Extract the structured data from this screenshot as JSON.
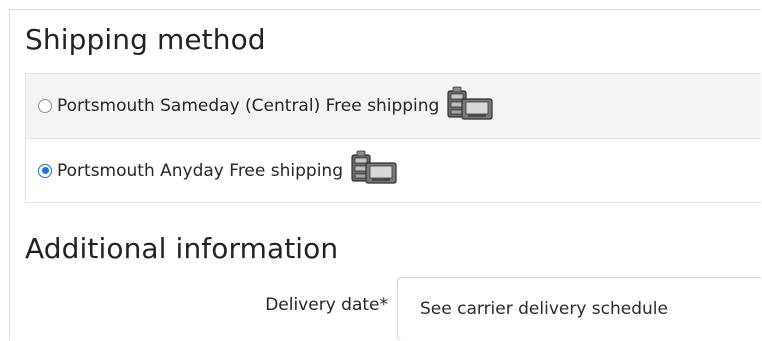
{
  "shipping": {
    "title": "Shipping method",
    "options": [
      {
        "label": "Portsmouth Sameday (Central) Free shipping",
        "selected": false,
        "icon": "carrier-truck-icon"
      },
      {
        "label": "Portsmouth Anyday Free shipping",
        "selected": true,
        "icon": "carrier-truck-icon"
      }
    ]
  },
  "additional": {
    "title": "Additional information",
    "delivery_date": {
      "label": "Delivery date*",
      "value": "See carrier delivery schedule"
    }
  },
  "colors": {
    "radio_checked": "#1f6fd6",
    "row_alt_bg": "#f4f4f4"
  }
}
